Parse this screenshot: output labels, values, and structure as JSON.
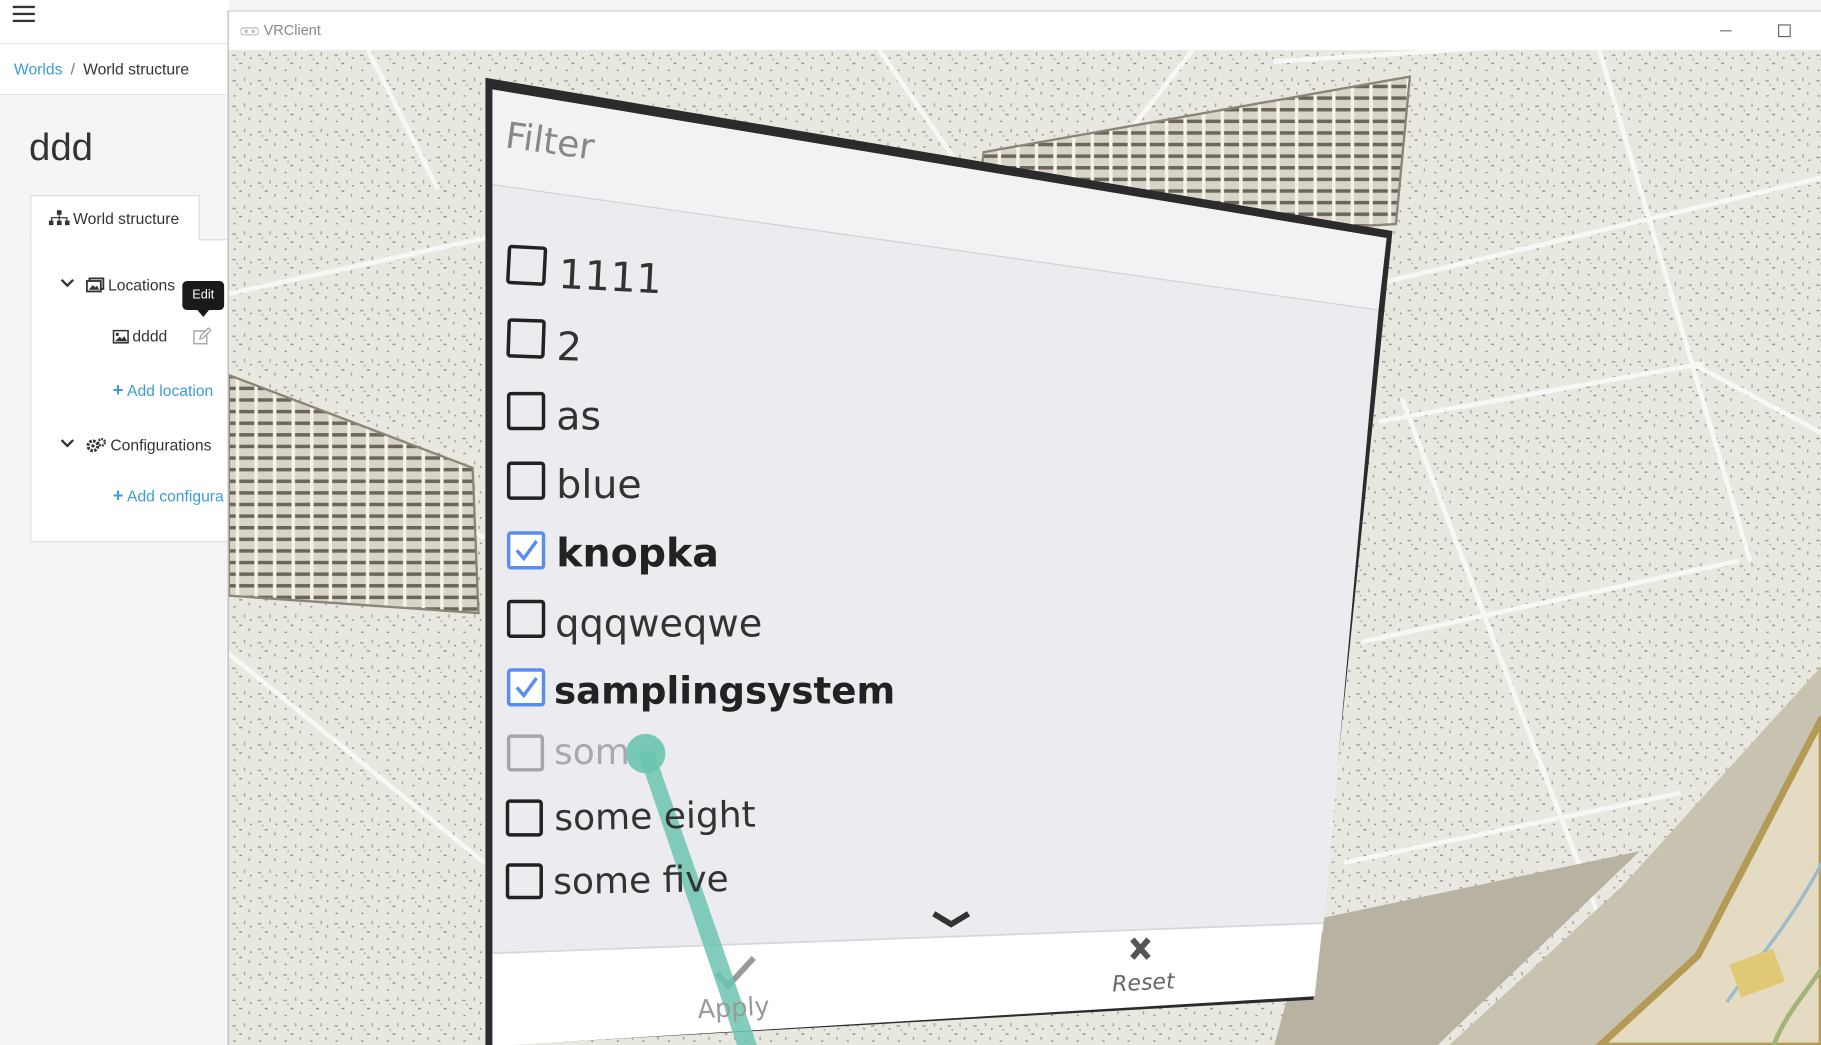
{
  "header": {
    "menu_icon": "hamburger-icon"
  },
  "breadcrumb": {
    "root": "Worlds",
    "separator": "/",
    "current": "World structure"
  },
  "page": {
    "title": "ddd"
  },
  "tabs": [
    {
      "label": "World structure",
      "icon": "sitemap-icon"
    }
  ],
  "tree": {
    "locations_label": "Locations",
    "location_items": [
      {
        "label": "dddd",
        "icon": "image-icon"
      }
    ],
    "add_location": "Add location",
    "configurations_label": "Configurations",
    "add_configuration": "Add configura"
  },
  "tooltip": {
    "text": "Edit"
  },
  "vr_window": {
    "title": "VRClient"
  },
  "filter_panel": {
    "title": "Filter",
    "options": [
      {
        "label": "1111",
        "checked": false
      },
      {
        "label": "2",
        "checked": false
      },
      {
        "label": "as",
        "checked": false
      },
      {
        "label": "blue",
        "checked": false
      },
      {
        "label": "knopka",
        "checked": true
      },
      {
        "label": "qqqweqwe",
        "checked": false
      },
      {
        "label": "samplingsystem",
        "checked": true
      },
      {
        "label": "som",
        "checked": false
      },
      {
        "label": "some eight",
        "checked": false
      },
      {
        "label": "some five",
        "checked": false
      }
    ],
    "apply_label": "Apply",
    "reset_label": "Reset"
  },
  "colors": {
    "link": "#3a9dd8",
    "checkbox_checked": "#5b8def",
    "pointer": "#6cc4b0",
    "ceiling": "#e9e8e1"
  }
}
